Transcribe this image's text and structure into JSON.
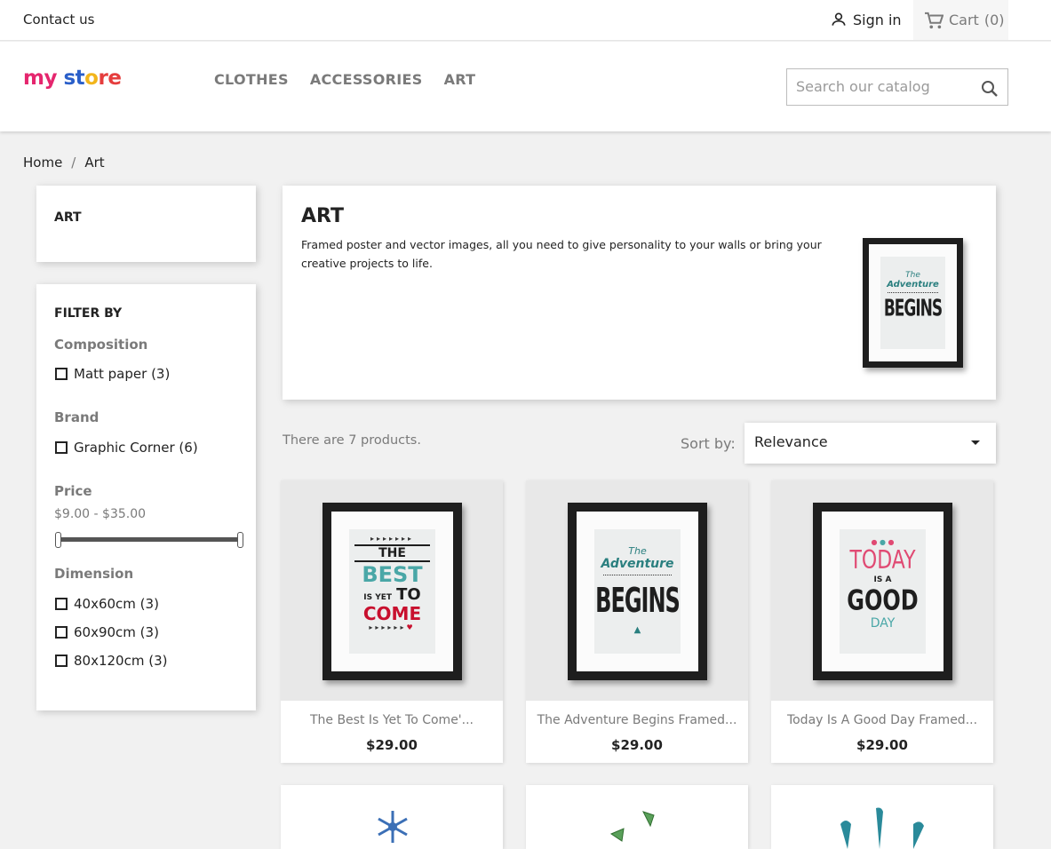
{
  "topbar": {
    "contact": "Contact us",
    "signin": "Sign in",
    "cart": "Cart",
    "cart_count": "(0)"
  },
  "header": {
    "logo": [
      "my",
      " ",
      "st",
      "o",
      "re"
    ],
    "menu": [
      "CLOTHES",
      "ACCESSORIES",
      "ART"
    ],
    "search_placeholder": "Search our catalog"
  },
  "breadcrumb": [
    "Home",
    "Art"
  ],
  "sidebar": {
    "category": "ART",
    "filter_title": "FILTER BY",
    "composition": {
      "title": "Composition",
      "options": [
        "Matt paper (3)"
      ]
    },
    "brand": {
      "title": "Brand",
      "options": [
        "Graphic Corner (6)"
      ]
    },
    "price": {
      "title": "Price",
      "range": "$9.00 - $35.00",
      "min": 9,
      "max": 35
    },
    "dimension": {
      "title": "Dimension",
      "options": [
        "40x60cm (3)",
        "60x90cm (3)",
        "80x120cm (3)"
      ]
    }
  },
  "category": {
    "title": "ART",
    "description": "Framed poster and vector images, all you need to give personality to your walls or bring your creative projects to life."
  },
  "listing": {
    "count": "There are 7 products.",
    "sort_label": "Sort by:",
    "sort_value": "Relevance"
  },
  "products": [
    {
      "name": "The Best Is Yet To Come'...",
      "price": "$29.00",
      "art": [
        "THE",
        "BEST",
        "IS YET",
        "TO",
        "COME"
      ]
    },
    {
      "name": "The Adventure Begins Framed...",
      "price": "$29.00",
      "art": [
        "The",
        "Adventure",
        "BEGINS"
      ]
    },
    {
      "name": "Today Is A Good Day Framed...",
      "price": "$29.00",
      "art": [
        "TODAY",
        "IS A",
        "GOOD",
        "DAY"
      ]
    }
  ],
  "catimg_art": [
    "The",
    "Adventure",
    "BEGINS"
  ],
  "colors": {
    "accent": "#24b9d7",
    "teal": "#2a7f7f",
    "red": "#c8102e",
    "pink": "#e04a73"
  }
}
